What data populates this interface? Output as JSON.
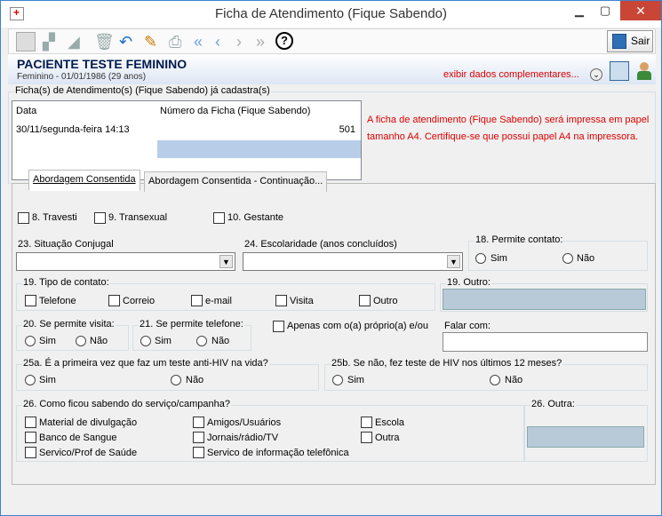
{
  "window": {
    "title": "Ficha de Atendimento (Fique Sabendo)",
    "minimize": "▁",
    "maximize": "▢",
    "close": "✕"
  },
  "toolbar": {
    "exit_label": "Sair",
    "icons": [
      "new-icon",
      "binoculars-icon",
      "eraser-icon",
      "trash-icon",
      "undo-icon",
      "edit-icon",
      "print-icon",
      "first-icon",
      "prev-icon",
      "next-icon",
      "last-icon",
      "help-icon"
    ]
  },
  "patient": {
    "name": "PACIENTE TESTE FEMININO",
    "info": "Feminino - 01/01/1986 (29 anos)",
    "complementary_link": "exibir dados complementares..."
  },
  "records": {
    "legend": "Ficha(s) de Atendimento(s) (Fique Sabendo) já cadastra(s)",
    "columns": [
      "Data",
      "Número da  Ficha (Fique Sabendo)"
    ],
    "rows": [
      {
        "date": "30/11/segunda-feira 14:13",
        "number": "501"
      }
    ]
  },
  "message": "A ficha de atendimento (Fique Sabendo) será impressa em papel tamanho A4. Certifique-se que possui papel A4 na impressora.",
  "tabs": [
    "Abordagem Consentida",
    "Abordagem Consentida - Continuação..."
  ],
  "form": {
    "cb8": "8. Travesti",
    "cb9": "9. Transexual",
    "cb10": "10. Gestante",
    "f23": "23. Situação Conjugal",
    "f24": "24. Escolaridade (anos concluídos)",
    "f18": "18. Permite contato:",
    "sim": "Sim",
    "nao": "Não",
    "f19": "19. Tipo de contato:",
    "c_tel": "Telefone",
    "c_cor": "Correio",
    "c_mail": "e-mail",
    "c_vis": "Visita",
    "c_out": "Outro",
    "f19o": "19. Outro:",
    "f20": "20. Se permite visita:",
    "f21": "21. Se permite telefone:",
    "apenas": "Apenas com o(a) próprio(a) e/ou",
    "falar": "Falar com:",
    "f25a": "25a. É a primeira vez que faz um teste anti-HIV na vida?",
    "f25b": "25b. Se não, fez teste de HIV nos últimos 12 meses?",
    "f26": "26. Como ficou sabendo do serviço/campanha?",
    "f26o": "26. Outra:",
    "s_mat": "Material de divulgação",
    "s_ban": "Banco de Sangue",
    "s_sp": "Servico/Prof de Saúde",
    "s_ami": "Amigos/Usuários",
    "s_jor": "Jornais/rádio/TV",
    "s_inf": "Servico de informação telefônica",
    "s_esc": "Escola",
    "s_out": "Outra"
  }
}
